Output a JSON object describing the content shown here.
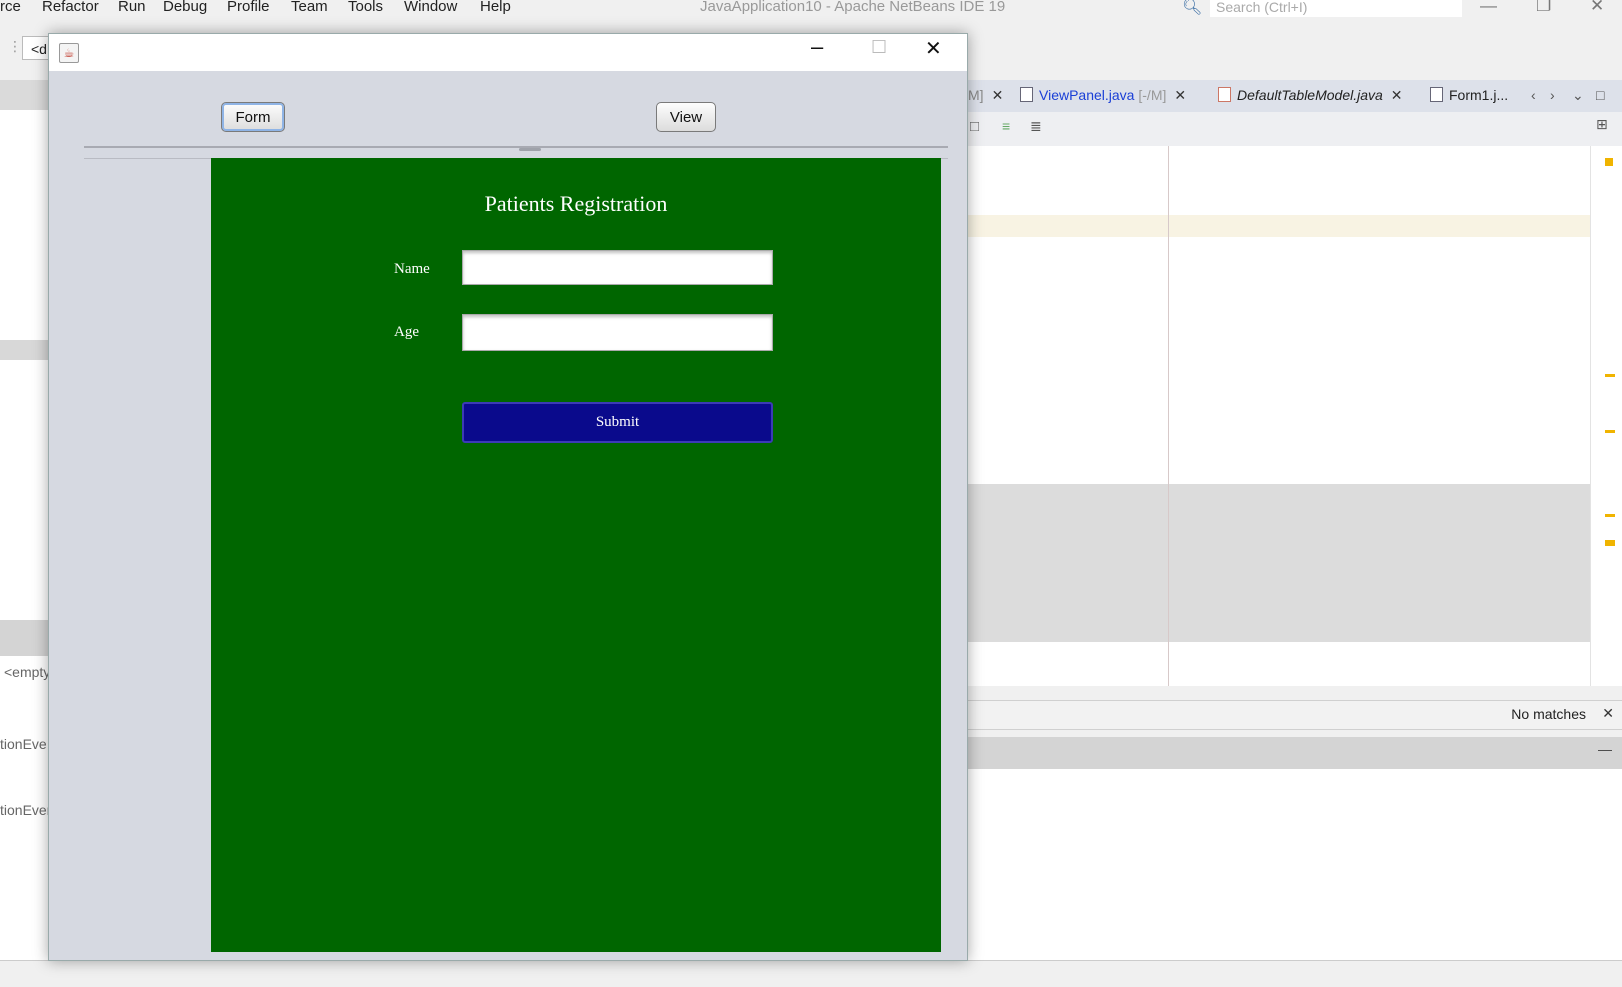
{
  "ide": {
    "menu": [
      "rce",
      "Refactor",
      "Run",
      "Debug",
      "Profile",
      "Team",
      "Tools",
      "Window",
      "Help"
    ],
    "title": "JavaApplication10 - Apache NetBeans IDE 19",
    "search_placeholder": "Search (Ctrl+I)",
    "combo_text": "<d",
    "left_texts": [
      "<empty",
      "tionEve",
      "tionEver"
    ],
    "tabs": [
      {
        "label": "M]",
        "suffix": ""
      },
      {
        "label": "ViewPanel.java",
        "suffix": " [-/M]"
      },
      {
        "label": "DefaultTableModel.java",
        "suffix": ""
      },
      {
        "label": "Form1.j...",
        "suffix": ""
      }
    ],
    "find_status": "No matches"
  },
  "window": {
    "toolbar": {
      "form_label": "Form",
      "view_label": "View"
    },
    "form": {
      "title": "Patients Registration",
      "name_label": "Name",
      "name_value": "",
      "age_label": "Age",
      "age_value": "",
      "submit_label": "Submit"
    },
    "colors": {
      "panel_bg": "#006600",
      "submit_bg": "#0a0a8c",
      "window_bg": "#d6d9e1"
    }
  }
}
